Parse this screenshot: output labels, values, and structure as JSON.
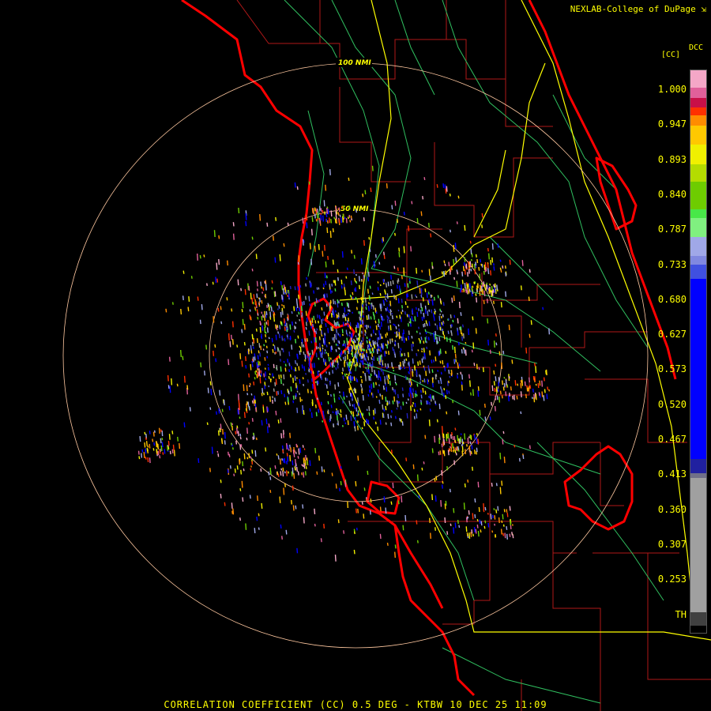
{
  "credit": "NEXLAB-College of DuPage",
  "credit_icon": "expand-arrow-icon",
  "footer": "CORRELATION COEFFICIENT (CC) 0.5 DEG - KTBW 10 DEC 25 11:09",
  "legend": {
    "product_code": "DCC",
    "unit": "[CC]",
    "ticks": [
      "1.000",
      "0.947",
      "0.893",
      "0.840",
      "0.787",
      "0.733",
      "0.680",
      "0.627",
      "0.573",
      "0.520",
      "0.467",
      "0.413",
      "0.360",
      "0.307",
      "0.253",
      "TH"
    ],
    "segments": [
      {
        "from": 1.0,
        "to": 0.975,
        "color": "#f4a7c7"
      },
      {
        "from": 0.975,
        "to": 0.96,
        "color": "#e0609a"
      },
      {
        "from": 0.96,
        "to": 0.947,
        "color": "#c81048"
      },
      {
        "from": 0.947,
        "to": 0.935,
        "color": "#ff3000"
      },
      {
        "from": 0.935,
        "to": 0.92,
        "color": "#ff8c00"
      },
      {
        "from": 0.92,
        "to": 0.893,
        "color": "#ffc800"
      },
      {
        "from": 0.893,
        "to": 0.865,
        "color": "#f0f000"
      },
      {
        "from": 0.865,
        "to": 0.84,
        "color": "#b4dc00"
      },
      {
        "from": 0.84,
        "to": 0.8,
        "color": "#6ecc00"
      },
      {
        "from": 0.8,
        "to": 0.787,
        "color": "#48e848"
      },
      {
        "from": 0.787,
        "to": 0.76,
        "color": "#80f080"
      },
      {
        "from": 0.76,
        "to": 0.733,
        "color": "#a0a8e8"
      },
      {
        "from": 0.733,
        "to": 0.72,
        "color": "#8088e0"
      },
      {
        "from": 0.72,
        "to": 0.7,
        "color": "#4050e0"
      },
      {
        "from": 0.7,
        "to": 0.44,
        "color": "#0000ff"
      },
      {
        "from": 0.44,
        "to": 0.42,
        "color": "#2020a0"
      },
      {
        "from": 0.42,
        "to": 0.413,
        "color": "#707088"
      },
      {
        "from": 0.413,
        "to": 0.22,
        "color": "#a0a0a0"
      },
      {
        "from": 0.22,
        "to": 0.2,
        "color": "#404040"
      },
      {
        "from": 0.2,
        "to": 0.19,
        "color": "#000000"
      }
    ]
  },
  "range_rings": [
    {
      "label": "100 NMI",
      "radius_nmi": 100
    },
    {
      "label": "50 NMI",
      "radius_nmi": 50
    }
  ],
  "radar": {
    "site": "KTBW",
    "tilt": "0.5 DEG",
    "product": "CORRELATION COEFFICIENT (CC)"
  },
  "colors": {
    "coastline": "#ff0000",
    "county_lines": "#b01818",
    "highways": "#ffff00",
    "roads": "#30c060",
    "ring": "#ffc8a0",
    "text": "#ffff00"
  }
}
